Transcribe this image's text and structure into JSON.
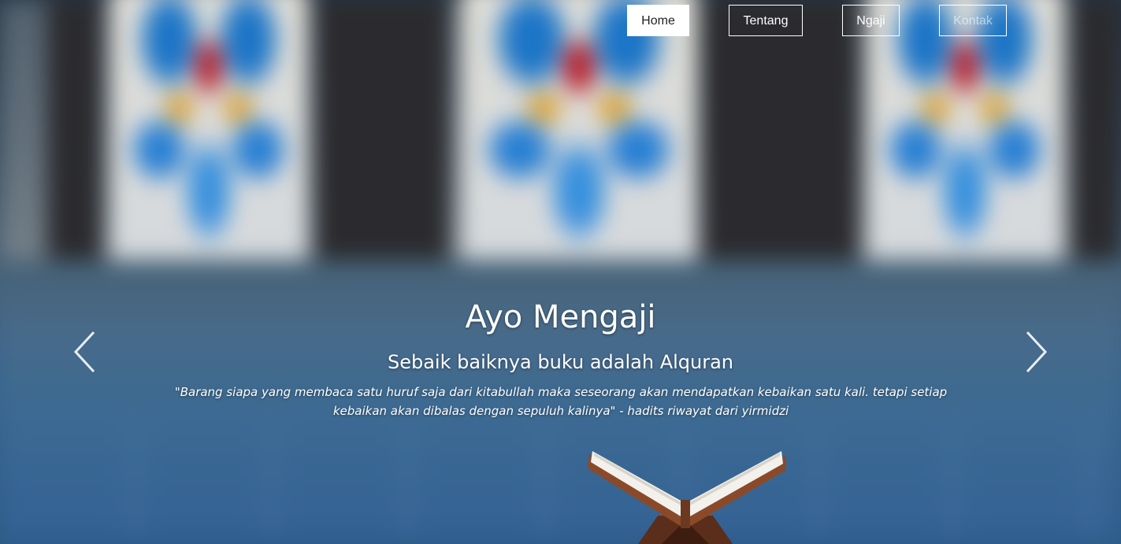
{
  "nav": {
    "items": [
      {
        "label": "Home",
        "active": true
      },
      {
        "label": "Tentang",
        "active": false
      },
      {
        "label": "Ngaji",
        "active": false
      },
      {
        "label": "Kontak",
        "active": false
      }
    ]
  },
  "carousel": {
    "title": "Ayo Mengaji",
    "subtitle": "Sebaik baiknya buku adalah Alquran",
    "quote": "\"Barang siapa yang membaca satu huruf saja dari kitabullah maka seseorang akan mendapatkan kebaikan satu kali. tetapi setiap kebaikan akan dibalas dengan sepuluh kalinya\" - hadits riwayat dari yirmidzi",
    "prev_icon": "chevron-left-icon",
    "next_icon": "chevron-right-icon"
  },
  "colors": {
    "nav_border": "#ffffff",
    "nav_active_bg": "#ffffff",
    "text": "#ffffff"
  }
}
